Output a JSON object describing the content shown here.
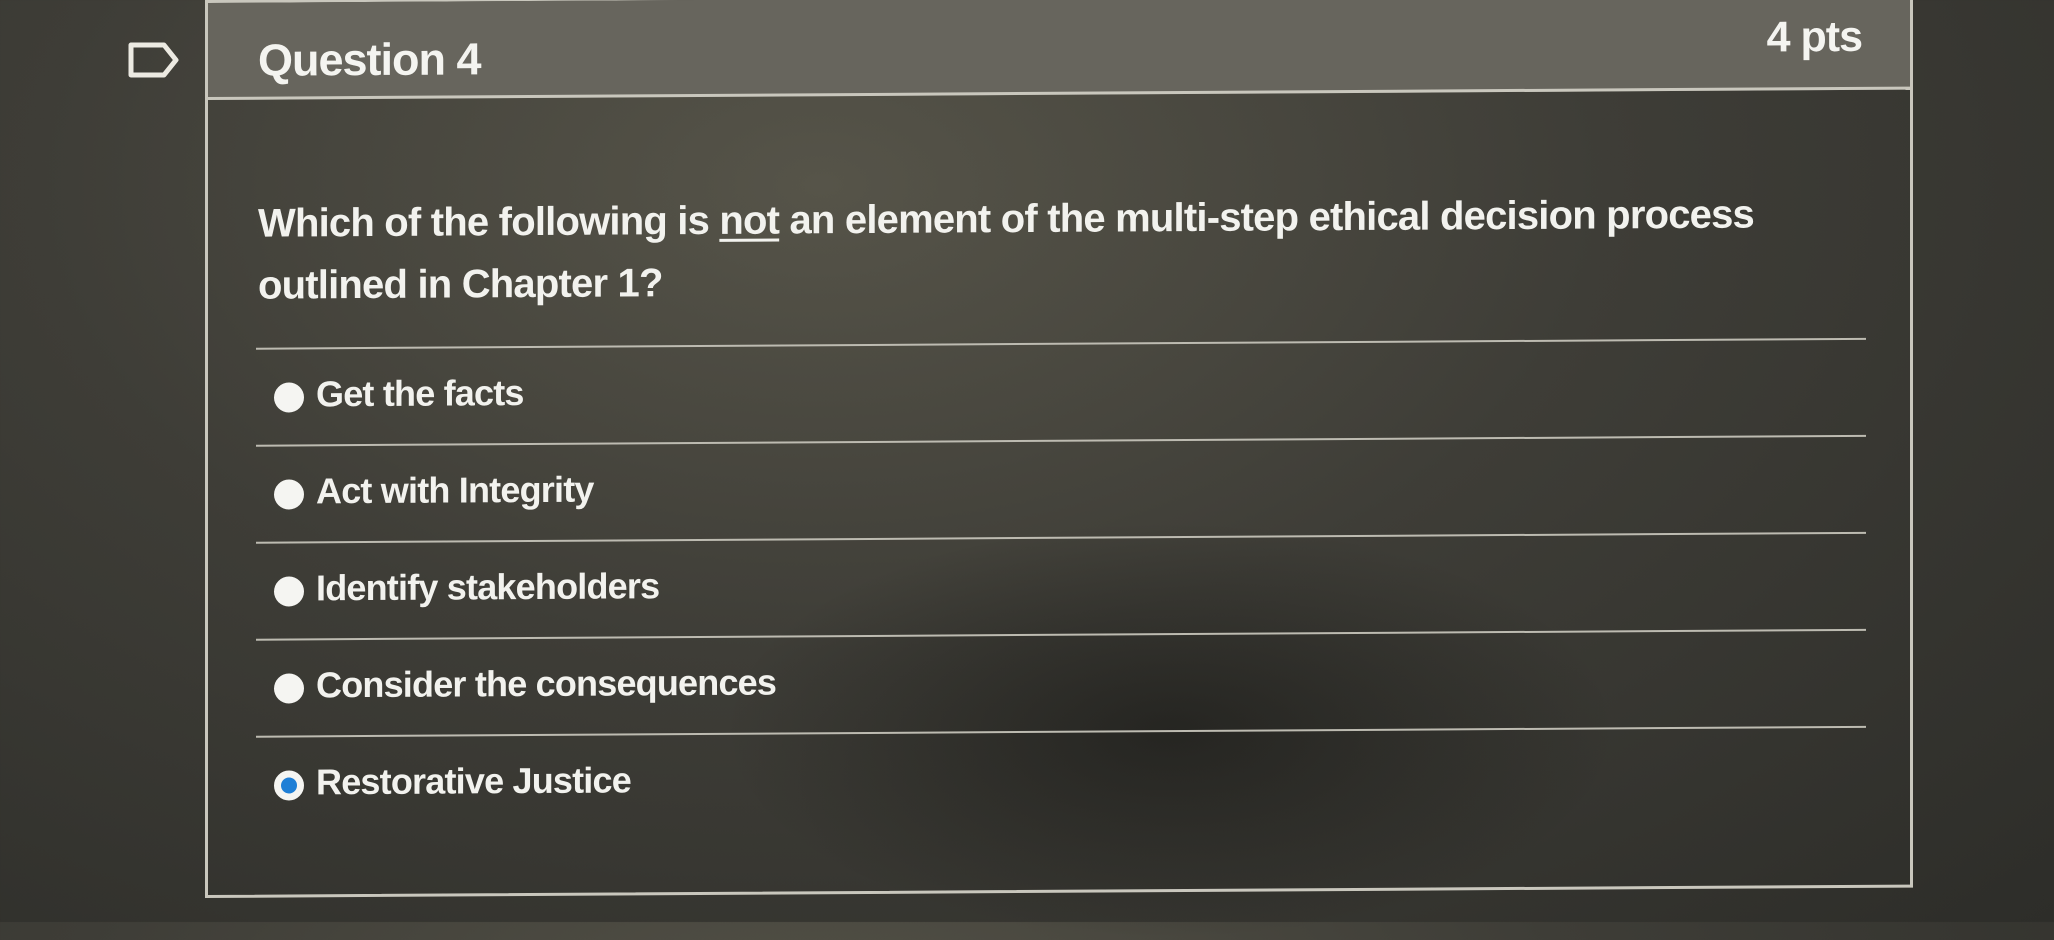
{
  "question": {
    "title": "Question 4",
    "points": "4 pts",
    "text_before": "Which of the following is ",
    "text_emphasis": "not",
    "text_after": " an element of the multi-step ethical decision process outlined in Chapter 1?"
  },
  "answers": [
    {
      "label": "Get the facts",
      "selected": false
    },
    {
      "label": "Act with Integrity",
      "selected": false
    },
    {
      "label": "Identify stakeholders",
      "selected": false
    },
    {
      "label": "Consider the consequences",
      "selected": false
    },
    {
      "label": "Restorative Justice",
      "selected": true
    }
  ],
  "colors": {
    "header_bg": "#67655d",
    "selected_radio": "#1f7fd6",
    "text": "#f2f2ee"
  }
}
